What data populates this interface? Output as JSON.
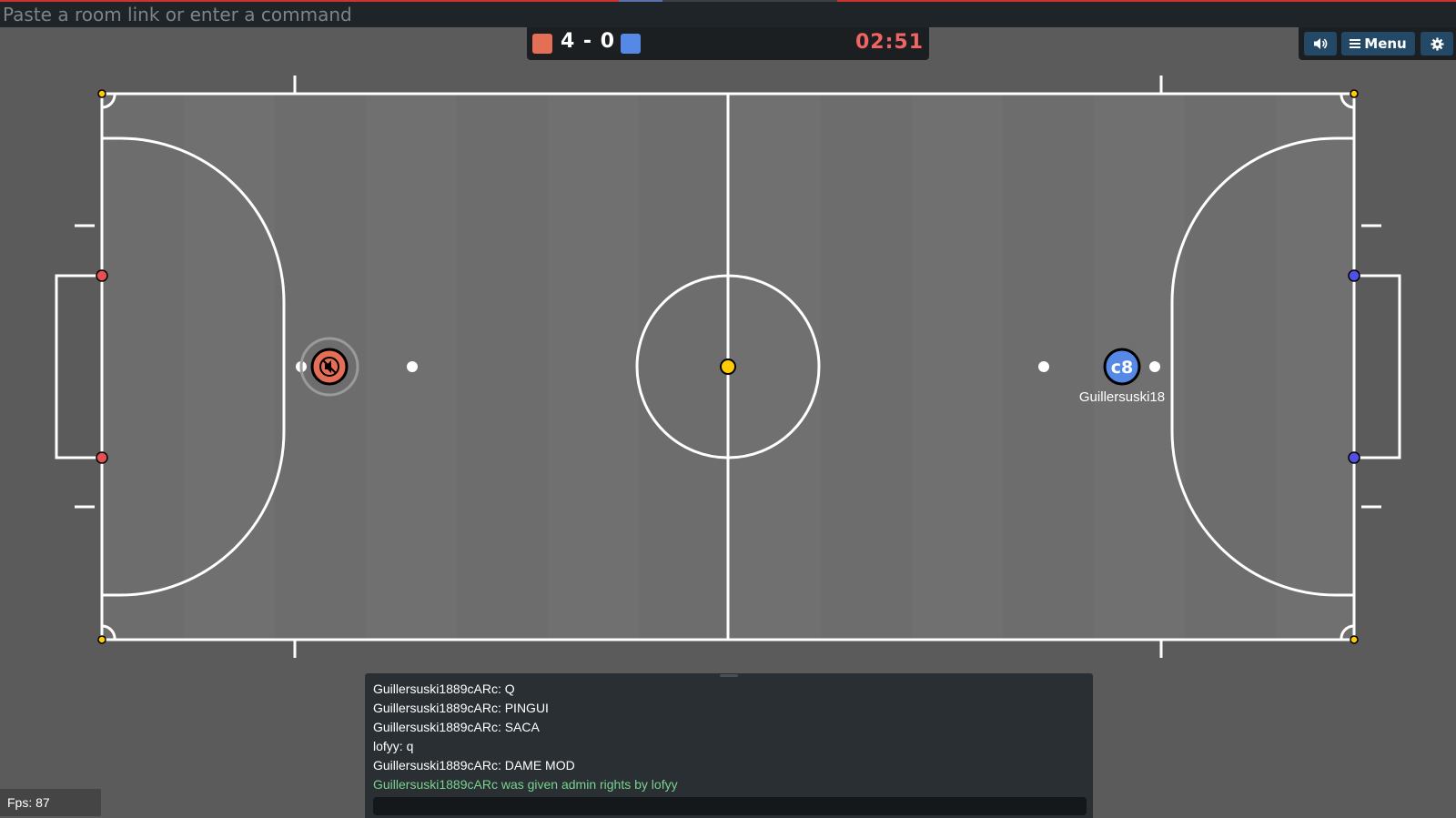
{
  "command_bar": {
    "placeholder": "Paste a room link or enter a command"
  },
  "scoreboard": {
    "red_score": 4,
    "blue_score": 0,
    "score_text": "4 - 0",
    "timer": "02:51",
    "colors": {
      "red": "#e56e56",
      "blue": "#5689e5",
      "timer": "#f06464"
    }
  },
  "toolbar": {
    "sound_icon": "speaker-icon",
    "menu_label": "Menu",
    "menu_icon": "hamburger-icon",
    "settings_icon": "gear-icon"
  },
  "players": [
    {
      "team": "red",
      "avatar": "",
      "icon": "muted-speaker-icon",
      "name": ""
    },
    {
      "team": "blue",
      "avatar": "c8",
      "name": "Guillersuski18"
    }
  ],
  "ball": {
    "color": "#ffcc00"
  },
  "chat": {
    "messages": [
      {
        "text": "Guillersuski1889cARc: Q",
        "type": "player"
      },
      {
        "text": "Guillersuski1889cARc: PINGUI",
        "type": "player"
      },
      {
        "text": "Guillersuski1889cARc: SACA",
        "type": "player"
      },
      {
        "text": "lofyy: q",
        "type": "player"
      },
      {
        "text": "Guillersuski1889cARc: DAME MOD",
        "type": "player"
      },
      {
        "text": "Guillersuski1889cARc was given admin rights by lofyy",
        "type": "system"
      }
    ]
  },
  "fps": "Fps: 87"
}
